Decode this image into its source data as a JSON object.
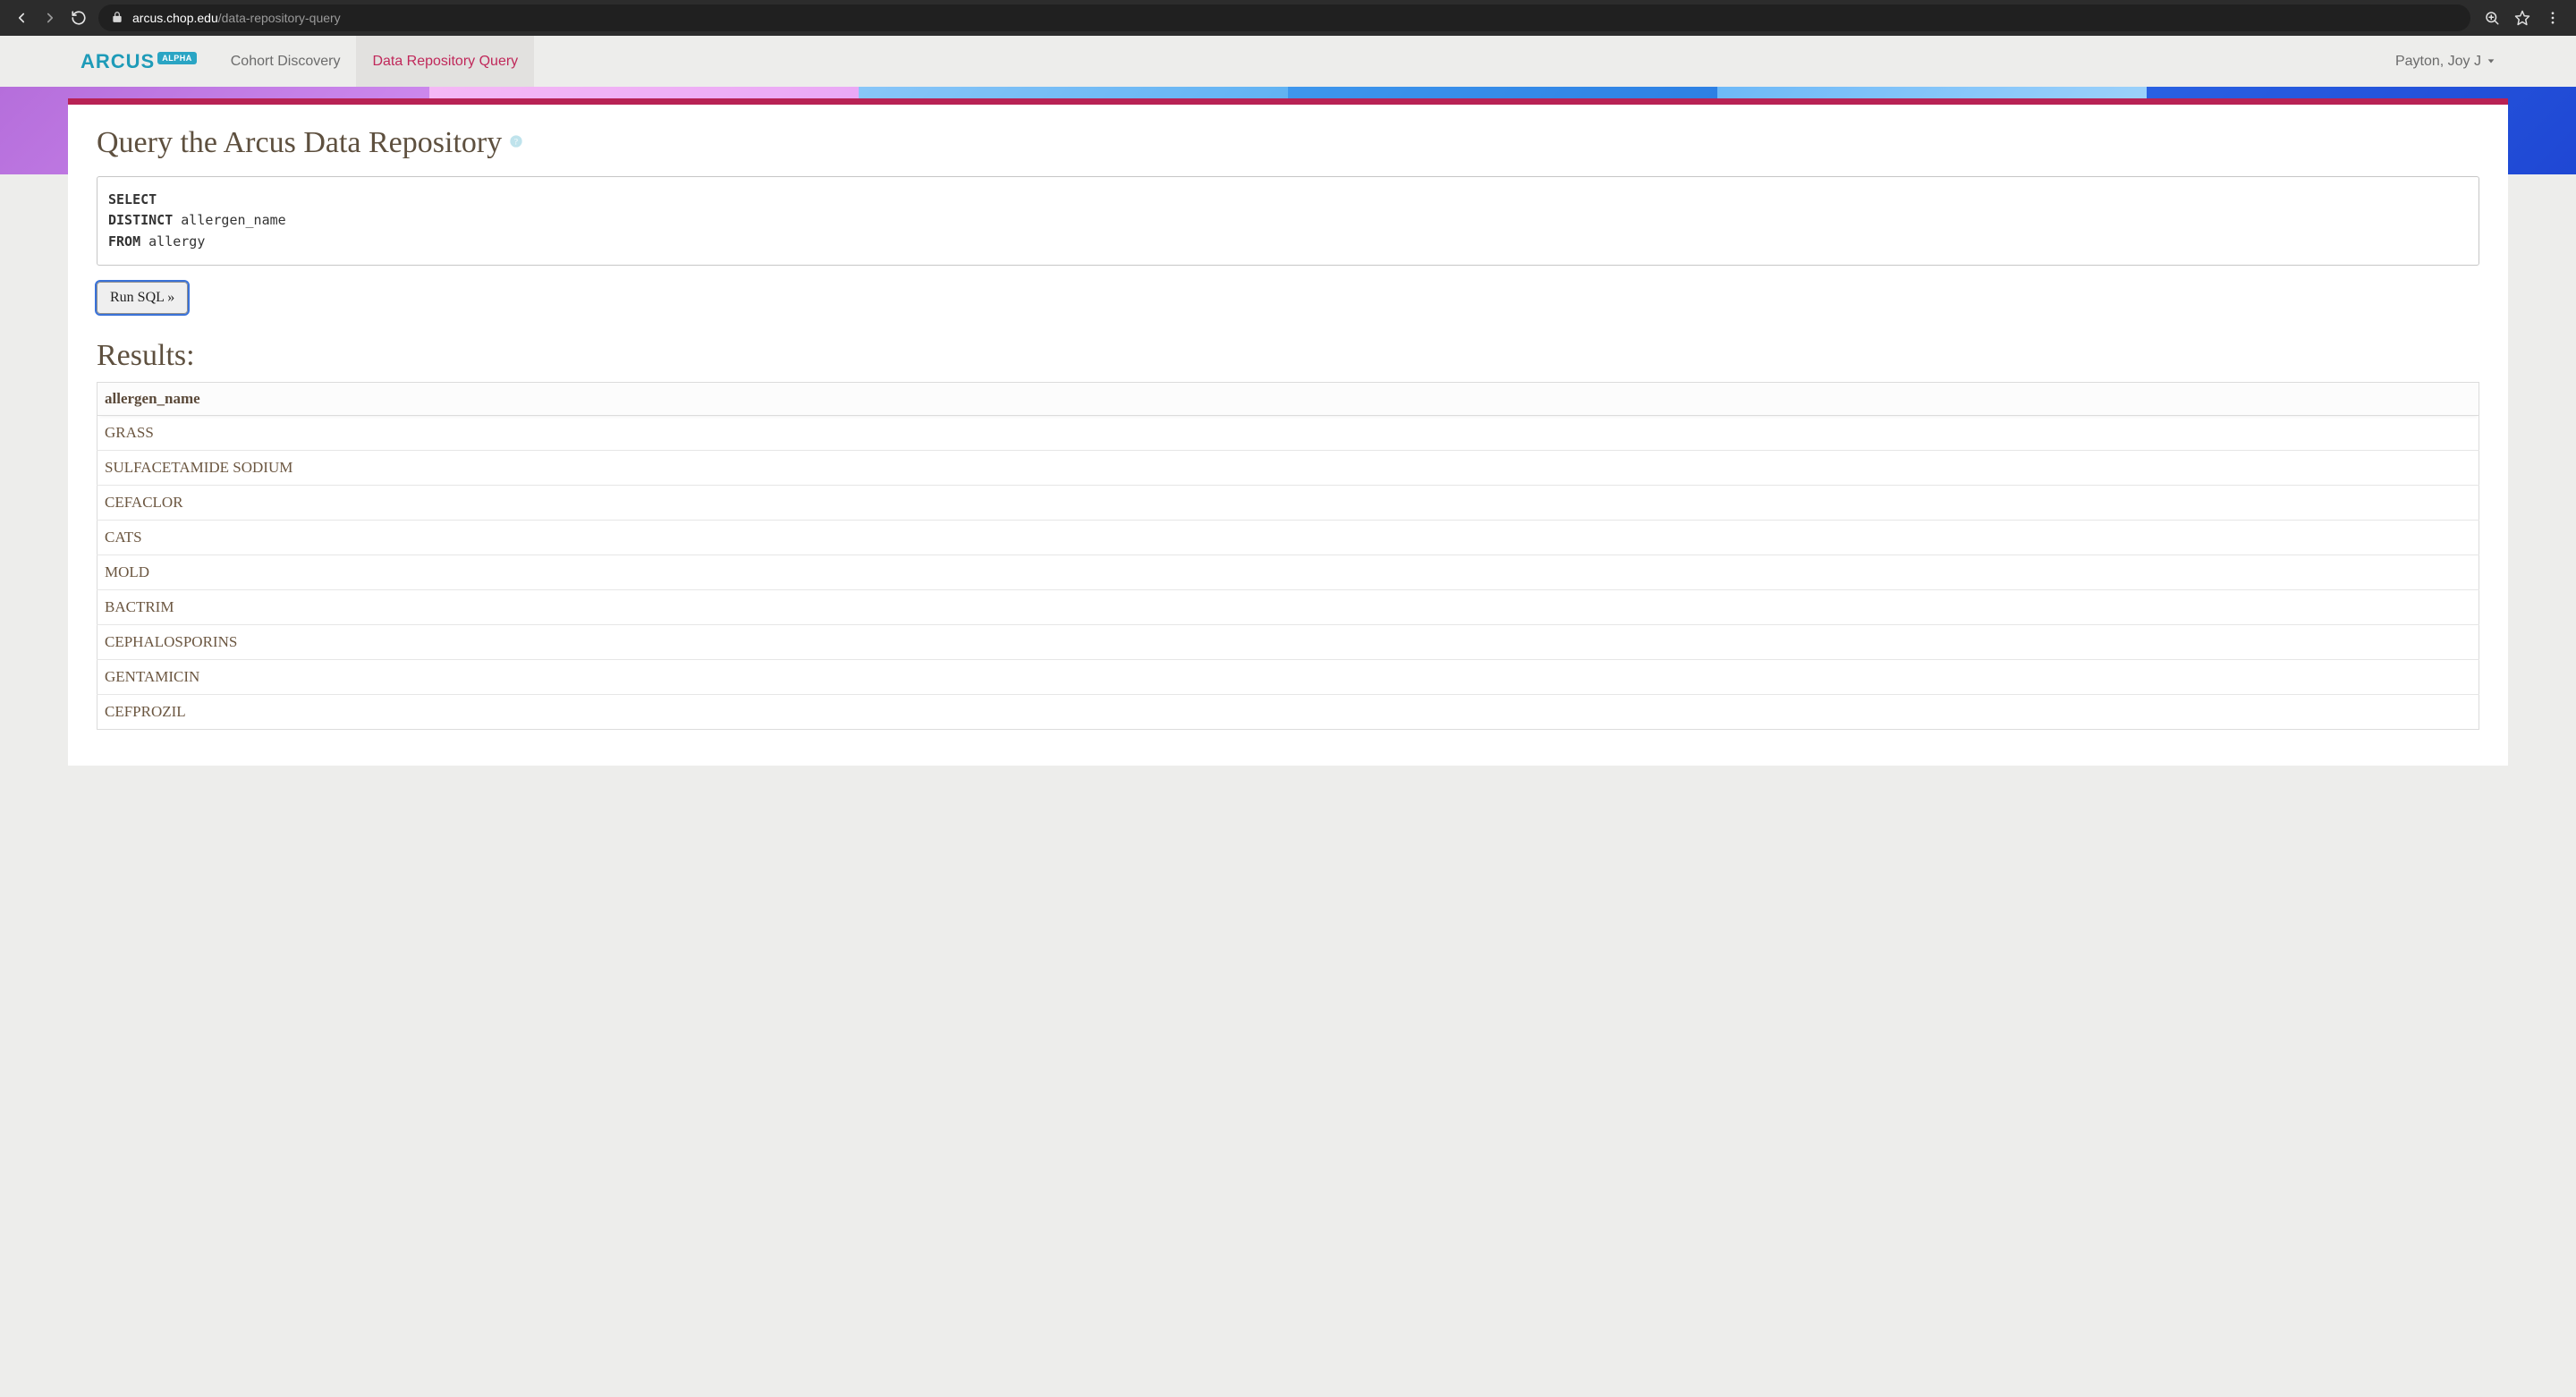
{
  "browser": {
    "url_domain": "arcus.chop.edu",
    "url_path": "/data-repository-query"
  },
  "header": {
    "logo_text": "ARCUS",
    "logo_badge": "ALPHA",
    "tabs": [
      {
        "label": "Cohort Discovery",
        "active": false
      },
      {
        "label": "Data Repository Query",
        "active": true
      }
    ],
    "user_name": "Payton, Joy J"
  },
  "page": {
    "title": "Query the Arcus Data Repository",
    "run_button": "Run SQL »",
    "results_heading": "Results:"
  },
  "sql": {
    "kw_select": "SELECT",
    "kw_distinct": "DISTINCT",
    "col": " allergen_name",
    "kw_from": "FROM",
    "table": " allergy"
  },
  "results": {
    "column_header": "allergen_name",
    "rows": [
      "GRASS",
      "SULFACETAMIDE SODIUM",
      "CEFACLOR",
      "CATS",
      "MOLD",
      "BACTRIM",
      "CEPHALOSPORINS",
      "GENTAMICIN",
      "CEFPROZIL"
    ]
  }
}
